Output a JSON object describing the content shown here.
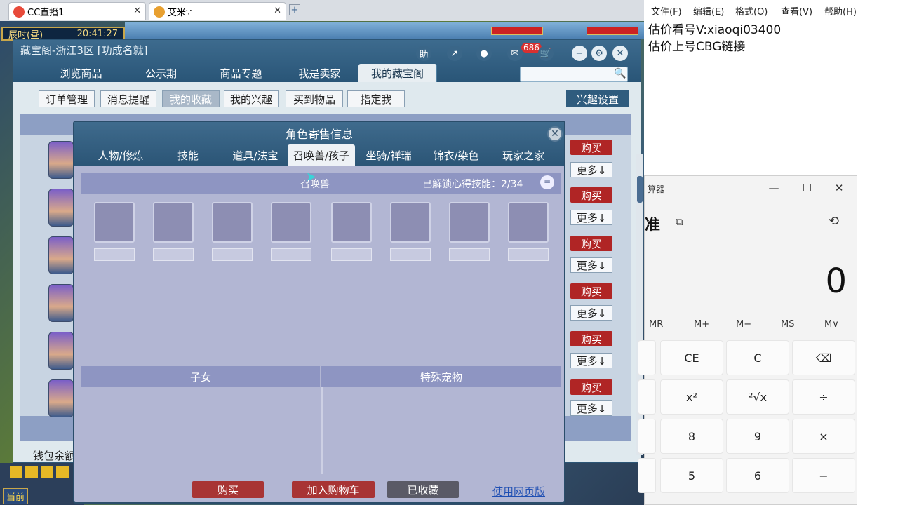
{
  "browser_tabs": [
    {
      "label": "CC直播1",
      "close": "✕"
    },
    {
      "label": "艾米∵",
      "close": "✕"
    }
  ],
  "new_tab": "+",
  "game": {
    "clock_period": "辰时(昼)",
    "clock_time": "20:41:27",
    "bottom_left_label": "当前"
  },
  "main_window": {
    "title": "藏宝阁-浙江3区 [功成名就]",
    "header_help": "助",
    "badge_count": "686",
    "tabs": [
      "浏览商品",
      "公示期",
      "商品专题",
      "我是卖家",
      "我的藏宝阁"
    ],
    "sub_buttons": [
      "订单管理",
      "消息提醒",
      "我的收藏",
      "我的兴趣",
      "买到物品",
      "指定我"
    ],
    "interest_settings": "兴趣设置",
    "wallet_label": "钱包余额",
    "buy_label": "购买",
    "more_label": "更多↓"
  },
  "dialog": {
    "title": "角色寄售信息",
    "close": "✕",
    "tabs": [
      "人物/修炼",
      "技能",
      "道具/法宝",
      "召唤兽/孩子",
      "坐骑/祥瑞",
      "锦衣/染色",
      "玩家之家"
    ],
    "pet_section_title": "召唤兽",
    "skill_info": "已解锁心得技能：2/34",
    "children_title": "子女",
    "special_pet_title": "特殊宠物",
    "buttons": {
      "buy": "购买",
      "add_cart": "加入购物车",
      "favorited": "已收藏",
      "web_version": "使用网页版"
    }
  },
  "notepad": {
    "menu": [
      "文件(F)",
      "编辑(E)",
      "格式(O)",
      "查看(V)",
      "帮助(H)"
    ],
    "lines": [
      "估价看号V:xiaoqi03400",
      "估价上号CBG链接"
    ]
  },
  "calculator": {
    "title": "算器",
    "mode": "准",
    "display": "0",
    "memory": [
      "MR",
      "M+",
      "M−",
      "MS",
      "M∨"
    ],
    "keys_row1": [
      "CE",
      "C",
      "⌫"
    ],
    "keys_row2": [
      "x²",
      "²√x",
      "÷"
    ],
    "keys_row3": [
      "8",
      "9",
      "×"
    ],
    "keys_row4": [
      "5",
      "6",
      "−"
    ]
  },
  "colors": {
    "header_blue": "#2b5576",
    "buy_red": "#b02525",
    "dialog_panel": "#b2b6d3",
    "section_header": "#8e95c2"
  }
}
